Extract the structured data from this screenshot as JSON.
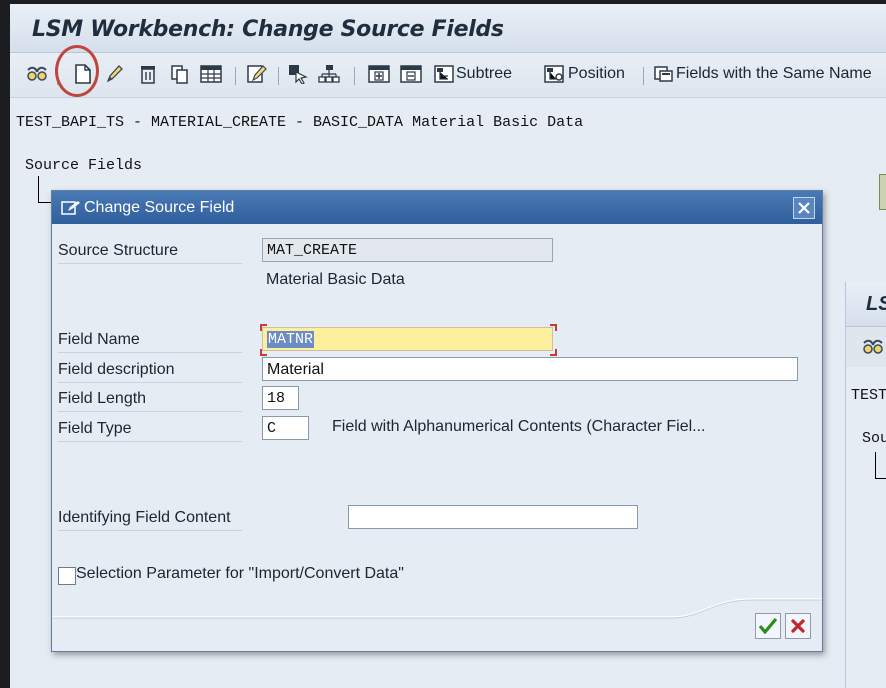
{
  "window": {
    "title": "LSM Workbench: Change Source Fields"
  },
  "toolbar": {
    "subtree_label": "Subtree",
    "position_label": "Position",
    "same_name_label": "Fields with the Same Name"
  },
  "breadcrumb": "TEST_BAPI_TS - MATERIAL_CREATE - BASIC_DATA Material Basic Data",
  "tree": {
    "root_label": "Source Fields"
  },
  "background_window": {
    "title_fragment": "LS",
    "breadcrumb_fragment": "TEST",
    "tree_fragment": "Sou"
  },
  "dialog": {
    "title": "Change Source Field",
    "source_structure_label": "Source Structure",
    "source_structure_value": "MAT_CREATE",
    "source_structure_desc": "Material Basic Data",
    "field_name_label": "Field Name",
    "field_name_value": "MATNR",
    "field_description_label": "Field description",
    "field_description_value": "Material",
    "field_length_label": "Field Length",
    "field_length_value": "18",
    "field_type_label": "Field Type",
    "field_type_value": "C",
    "field_type_desc": "Field with Alphanumerical Contents (Character Fiel...",
    "identifying_label": "Identifying Field Content",
    "identifying_value": "",
    "selection_param_label": "Selection Parameter for \"Import/Convert Data\"",
    "selection_param_checked": false
  },
  "colors": {
    "dialog_title_bg": "#2f5e9c",
    "highlight_circle": "#c0453d",
    "focus_field_bg": "#fcef9e",
    "ok_green": "#2e8b1f",
    "cancel_red": "#c0272d"
  }
}
